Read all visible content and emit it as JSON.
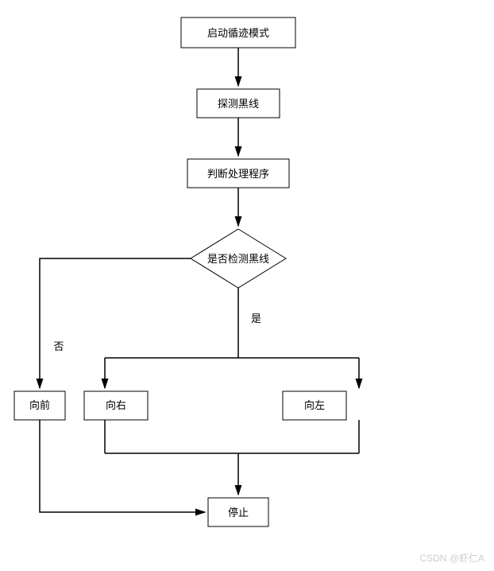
{
  "nodes": {
    "start": "启动循迹模式",
    "detect": "探测黑线",
    "process": "判断处理程序",
    "decision": "是否检测黑线",
    "forward": "向前",
    "right": "向右",
    "left": "向左",
    "stop": "停止"
  },
  "labels": {
    "yes": "是",
    "no": "否"
  },
  "watermark": "CSDN @虾仁A"
}
